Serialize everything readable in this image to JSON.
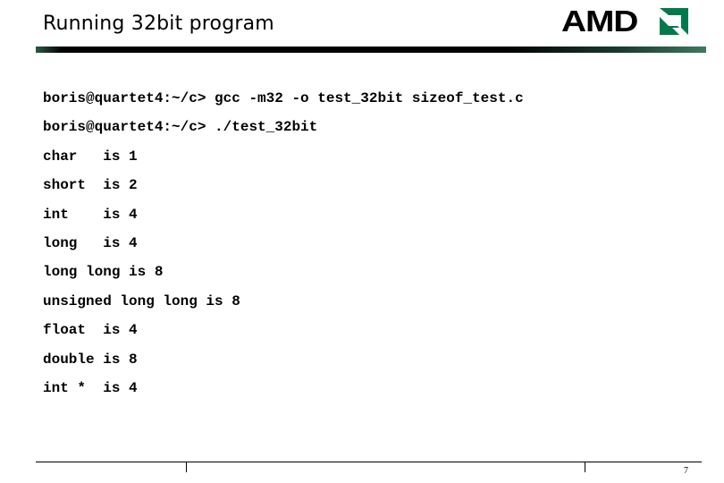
{
  "slide": {
    "title": "Running 32bit program",
    "logo_text": "AMD",
    "page_number": "7",
    "colors": {
      "accent_green": "#007a4d",
      "text": "#000000"
    }
  },
  "terminal": {
    "lines": [
      "boris@quartet4:~/c> gcc -m32 -o test_32bit sizeof_test.c",
      "boris@quartet4:~/c> ./test_32bit",
      "char   is 1",
      "short  is 2",
      "int    is 4",
      "long   is 4",
      "long long is 8",
      "unsigned long long is 8",
      "float  is 4",
      "double is 8",
      "int *  is 4"
    ]
  }
}
